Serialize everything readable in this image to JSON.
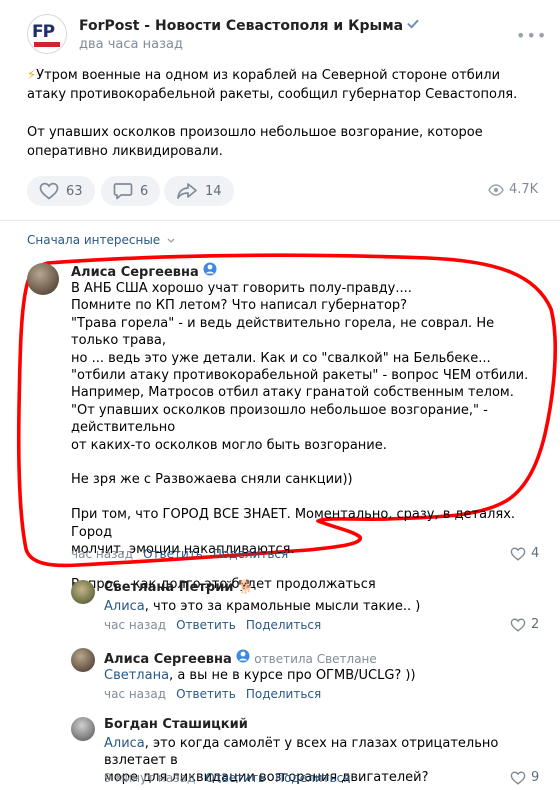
{
  "post": {
    "channel_name": "ForPost - Новости Севастополя и Крыма",
    "logo_text": "FP",
    "time": "два часа назад",
    "text_p1": "Утром военные на одном из кораблей на Северной стороне отбили атаку противокорабельной ракеты, сообщил губернатор Севастополя.",
    "text_p2": "От упавших осколков произошло небольшое возгорание, которое оперативно ликвидировали.",
    "likes": "63",
    "comments": "6",
    "shares": "14",
    "views": "4.7K"
  },
  "comments_sort": "Сначала интересные",
  "comments": [
    {
      "author": "Алиса Сергеевна",
      "lines": [
        "В АНБ США хорошо учат говорить полу-правду....",
        "Помните по КП летом? Что написал губернатор?",
        "\"Трава горела\" - и ведь действительно горела, не соврал. Не только трава,",
        "но ... ведь это уже детали. Как и со \"свалкой\" на Бельбеке...",
        "\"отбили атаку противокорабельной ракеты\" - вопрос ЧЕМ отбили.",
        "Например, Матросов отбил атаку гранатой собственным телом.",
        "\"От упавших осколков произошло небольшое возгорание,\" - действительно",
        "от каких-то осколков могло быть возгорание.",
        "",
        "Не зря же с Развожаева сняли санкции))",
        "",
        "При том, что ГОРОД ВСЕ ЗНАЕТ. Моментально, сразу, в деталях. Город",
        "молчит, эмоции накапливаются.",
        "",
        "Вопрос - как долго это будет продолжаться"
      ],
      "time": "час назад",
      "reply": "Ответить",
      "share": "Поделиться",
      "likes": "4"
    },
    {
      "author": "Светлана Петрий",
      "mention": "Алиса",
      "text": ", что это за крамольные мысли такие.. )",
      "time": "час назад",
      "reply": "Ответить",
      "share": "Поделиться",
      "likes": "2"
    },
    {
      "author": "Алиса Сергеевна",
      "reply_to": "ответила Светлане",
      "mention": "Светлана",
      "text": ", а вы не в курсе про ОГМВ/UCLG? ))",
      "time": "час назад",
      "reply": "Ответить",
      "share": "Поделиться"
    },
    {
      "author": "Богдан Сташицкий",
      "mention": "Алиса",
      "text": ", это когда самолёт у всех на глазах отрицательно взлетает в",
      "text2": "море для ликвидации возгорания двигателей?",
      "time": "9 минут назад",
      "reply": "Ответить",
      "share": "Поделиться",
      "likes": "9"
    }
  ],
  "colors": {
    "accent": "#2a5885",
    "highlight": "#ff0000",
    "muted": "#818c99"
  }
}
